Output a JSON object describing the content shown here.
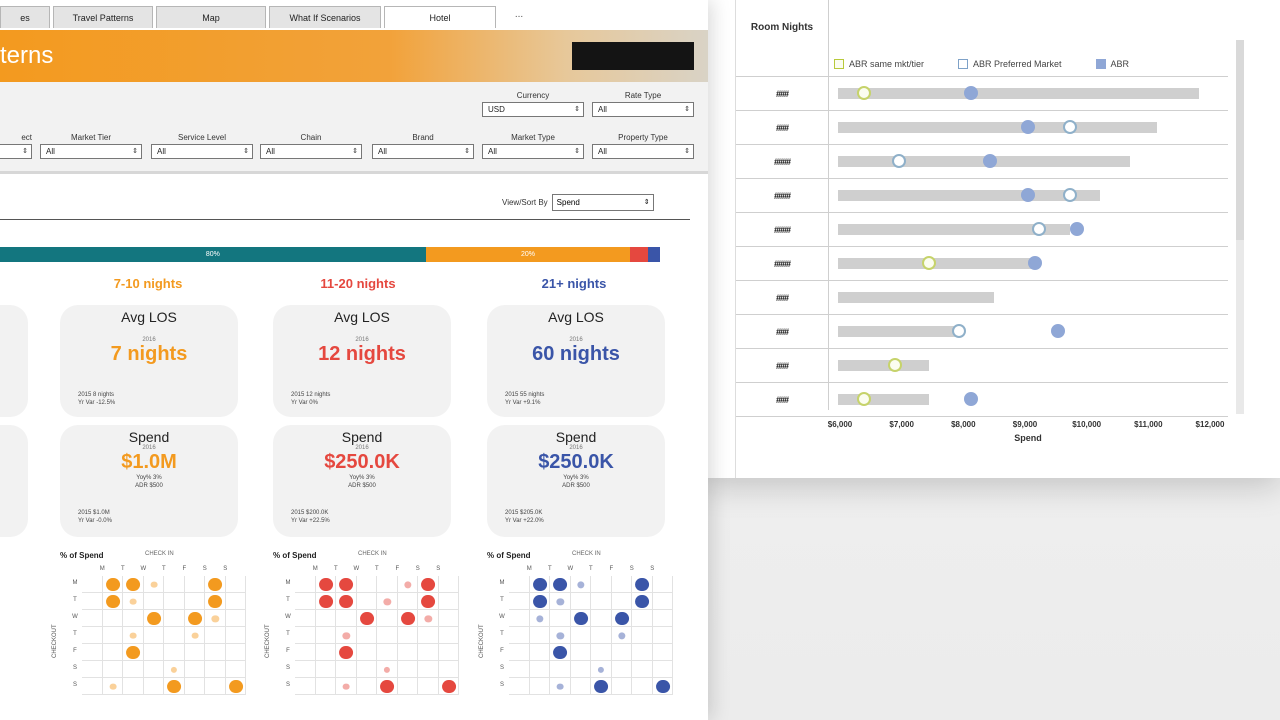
{
  "tabs": [
    {
      "label": "es",
      "active": false
    },
    {
      "label": "Travel Patterns",
      "active": false
    },
    {
      "label": "Map",
      "active": false
    },
    {
      "label": "What If Scenarios",
      "active": false
    },
    {
      "label": "Hotel",
      "active": true
    }
  ],
  "tab_more": "...",
  "banner": {
    "title": "terns"
  },
  "filters": {
    "currency": {
      "label": "Currency",
      "value": "USD"
    },
    "rate_type": {
      "label": "Rate Type",
      "value": "All"
    },
    "cut": {
      "label": "ect",
      "value": ""
    },
    "market_tier": {
      "label": "Market Tier",
      "value": "All"
    },
    "service_level": {
      "label": "Service Level",
      "value": "All"
    },
    "chain": {
      "label": "Chain",
      "value": "All"
    },
    "brand": {
      "label": "Brand",
      "value": "All"
    },
    "market_type": {
      "label": "Market Type",
      "value": "All"
    },
    "property_type": {
      "label": "Property Type",
      "value": "All"
    }
  },
  "view_sort": {
    "label": "View/Sort By",
    "value": "Spend"
  },
  "stackbar": {
    "segments": [
      {
        "label": "80%",
        "share": 0.645,
        "color": "#13767f"
      },
      {
        "label": "20%",
        "share": 0.31,
        "color": "#f39a1f"
      },
      {
        "label": "",
        "share": 0.027,
        "color": "#e5483f"
      },
      {
        "label": "",
        "share": 0.018,
        "color": "#3a55a8"
      }
    ]
  },
  "groups": [
    {
      "title": "7-10 nights",
      "color": "#f39a1f",
      "los": {
        "heading": "Avg LOS",
        "year": "2016",
        "value": "7 nights",
        "note1": "2015 8 nights",
        "note2": "Yr Var -12.5%"
      },
      "spend": {
        "heading": "Spend",
        "year": "2016",
        "value": "$1.0M",
        "sub1": "Yoy% 3%",
        "sub2": "ADR $500",
        "note1": "2015 $1.0M",
        "note2": "Yr Var -0.0%"
      },
      "grid": {
        "title": "% of Spend",
        "sub": "CHECK IN",
        "axis": "CHECKOUT"
      }
    },
    {
      "title": "11-20 nights",
      "color": "#e5483f",
      "los": {
        "heading": "Avg LOS",
        "year": "2016",
        "value": "12 nights",
        "note1": "2015 12 nights",
        "note2": "Yr Var 0%"
      },
      "spend": {
        "heading": "Spend",
        "year": "2016",
        "value": "$250.0K",
        "sub1": "Yoy% 3%",
        "sub2": "ADR $500",
        "note1": "2015 $200.0K",
        "note2": "Yr Var +22.5%"
      },
      "grid": {
        "title": "% of Spend",
        "sub": "CHECK IN",
        "axis": "CHECKOUT"
      }
    },
    {
      "title": "21+ nights",
      "color": "#3a55a8",
      "los": {
        "heading": "Avg LOS",
        "year": "2016",
        "value": "60 nights",
        "note1": "2015 55 nights",
        "note2": "Yr Var +9.1%"
      },
      "spend": {
        "heading": "Spend",
        "year": "2016",
        "value": "$250.0K",
        "sub1": "Yoy% 3%",
        "sub2": "ADR $500",
        "note1": "2015 $205.0K",
        "note2": "Yr Var +22.0%"
      },
      "grid": {
        "title": "% of Spend",
        "sub": "CHECK IN",
        "axis": "CHECKOUT"
      }
    }
  ],
  "heat_days": [
    "M",
    "T",
    "W",
    "T",
    "F",
    "S",
    "S"
  ],
  "back_chart": {
    "room_nights_header": "Room Nights",
    "legend": [
      "ABR same mkt/tier",
      "ABR Preferred Market",
      "ABR"
    ],
    "xlabel": "Spend",
    "xticks": [
      "$6,000",
      "$7,000",
      "$8,000",
      "$9,000",
      "$10,000",
      "$11,000",
      "$12,000"
    ],
    "rows": [
      {
        "nights": "###",
        "bar": [
          0.01,
          0.96
        ],
        "a": 0.08,
        "b": null,
        "c": 0.36
      },
      {
        "nights": "###",
        "bar": [
          0.01,
          0.85
        ],
        "a": null,
        "b": 0.62,
        "c": 0.51
      },
      {
        "nights": "####",
        "bar": [
          0.01,
          0.78
        ],
        "a": null,
        "b": 0.17,
        "c": 0.41
      },
      {
        "nights": "####",
        "bar": [
          0.01,
          0.7
        ],
        "a": null,
        "b": 0.62,
        "c": 0.51
      },
      {
        "nights": "####",
        "bar": [
          0.01,
          0.62
        ],
        "a": null,
        "b": 0.54,
        "c": 0.64
      },
      {
        "nights": "####",
        "bar": [
          0.01,
          0.53
        ],
        "a": 0.25,
        "b": null,
        "c": 0.53
      },
      {
        "nights": "###",
        "bar": [
          0.01,
          0.42
        ],
        "a": null,
        "b": null,
        "c": null
      },
      {
        "nights": "###",
        "bar": [
          0.01,
          0.33
        ],
        "a": null,
        "b": 0.33,
        "c": 0.59
      },
      {
        "nights": "###",
        "bar": [
          0.01,
          0.25
        ],
        "a": 0.16,
        "b": null,
        "c": null
      },
      {
        "nights": "###",
        "bar": [
          0.01,
          0.25
        ],
        "a": 0.08,
        "b": null,
        "c": 0.36
      }
    ]
  }
}
